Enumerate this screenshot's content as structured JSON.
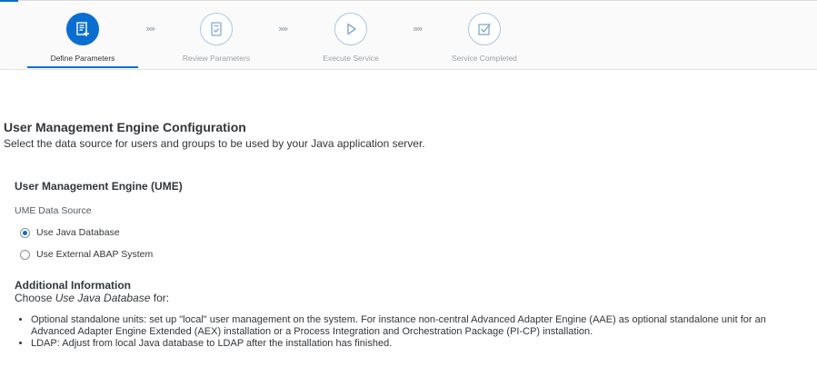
{
  "wizard": {
    "steps": [
      {
        "label": "Define Parameters",
        "icon": "edit-document-icon",
        "active": true
      },
      {
        "label": "Review Parameters",
        "icon": "review-document-icon",
        "active": false
      },
      {
        "label": "Execute Service",
        "icon": "play-icon",
        "active": false
      },
      {
        "label": "Service Completed",
        "icon": "checkbox-check-icon",
        "active": false
      }
    ],
    "separator": "»»"
  },
  "page": {
    "title": "User Management Engine Configuration",
    "subtitle": "Select the data source for users and groups to be used by your Java application server."
  },
  "ume": {
    "section_title": "User Management Engine (UME)",
    "data_source_label": "UME Data Source",
    "options": [
      {
        "label": "Use Java Database",
        "selected": true
      },
      {
        "label": "Use External ABAP System",
        "selected": false
      }
    ]
  },
  "info": {
    "title": "Additional Information",
    "choose_prefix": "Choose ",
    "choose_emphasis": "Use Java Database",
    "choose_suffix": " for:",
    "bullets": [
      "Optional standalone units: set up \"local\" user management on the system. For instance non-central Advanced Adapter Engine (AAE) as optional standalone unit for an Advanced Adapter Engine Extended (AEX) installation or a Process Integration and Orchestration Package (PI-CP) installation.",
      "LDAP: Adjust from local Java database to LDAP after the installation has finished."
    ]
  },
  "colors": {
    "accent": "#0a6ed1",
    "inactive_step": "#a9c7e3"
  }
}
